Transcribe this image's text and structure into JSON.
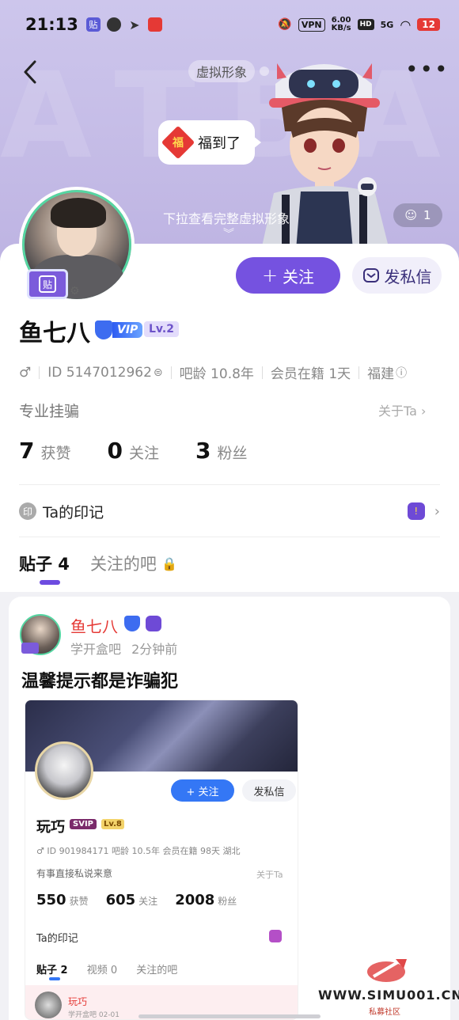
{
  "status_bar": {
    "time": "21:13",
    "vpn": "VPN",
    "speed_value": "6.00",
    "speed_unit": "KB/s",
    "hd": "HD",
    "network": "5G",
    "battery": "12"
  },
  "header": {
    "virtual_tag": "虚拟形象",
    "bubble_text": "福到了",
    "bubble_icon_char": "福",
    "pull_hint": "下拉查看完整虚拟形象",
    "like_count": "1"
  },
  "profile": {
    "tieba_badge_char": "贴",
    "follow_label": "关注",
    "message_label": "发私信",
    "name": "鱼七八",
    "vip_label": "VIP",
    "level": "Lv.2",
    "gender_symbol": "♂",
    "id_text": "ID 5147012962",
    "age": "吧龄 10.8年",
    "membership": "会员在籍 1天",
    "location": "福建",
    "bio": "专业挂骗",
    "about": "关于Ta",
    "stats": {
      "likes_num": "7",
      "likes_label": "获赞",
      "following_num": "0",
      "following_label": "关注",
      "fans_num": "3",
      "fans_label": "粉丝"
    },
    "mark_icon_char": "印",
    "mark_label": "Ta的印记"
  },
  "tabs": [
    {
      "label": "贴子 4"
    },
    {
      "label": "关注的吧"
    }
  ],
  "post": {
    "author": "鱼七八",
    "forum": "学开盒吧",
    "time": "2分钟前",
    "title": "温馨提示都是诈骗犯",
    "screenshot": {
      "follow": "+ 关注",
      "message": "发私信",
      "name": "玩巧",
      "svip": "SVIP",
      "level": "Lv.8",
      "meta": "♂  ID 901984171  吧龄 10.5年  会员在籍 98天  湖北",
      "bio": "有事直接私说来意",
      "about": "关于Ta",
      "likes_num": "550",
      "likes_label": "获赞",
      "following_num": "605",
      "following_label": "关注",
      "fans_num": "2008",
      "fans_label": "粉丝",
      "mark": "Ta的印记",
      "tab_posts": "贴子 2",
      "tab_video": "视频 0",
      "tab_forums": "关注的吧",
      "inner_name": "玩巧",
      "inner_sub": "学开盒吧  02-01"
    }
  },
  "watermark": {
    "site": "WWW.SIMU001.CN",
    "label": "私募社区"
  },
  "colors": {
    "accent": "#7552e0",
    "banner": "#c4bbe6",
    "name_red": "#e53935"
  }
}
